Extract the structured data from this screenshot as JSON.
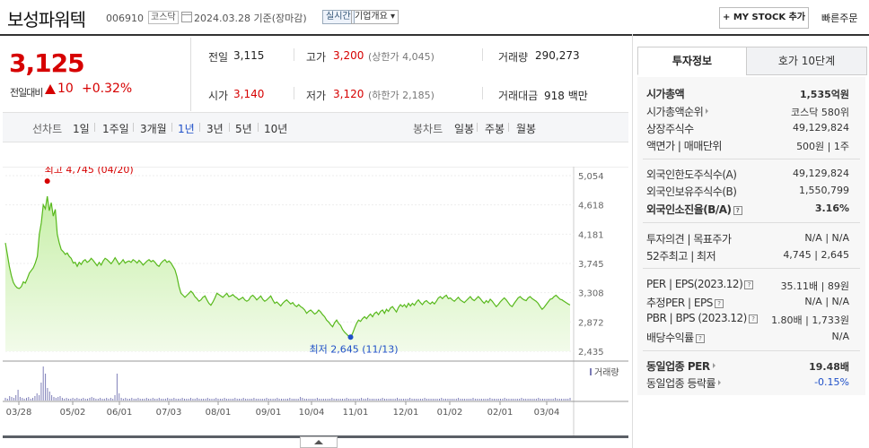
{
  "header": {
    "stock_name": "보성파워텍",
    "stock_code": "006910",
    "market": "코스닥",
    "date_text": "2024.03.28  기준(장마감)",
    "realtime_label": "실시간",
    "company_overview": "기업개요 ▾",
    "mystock_button": "+ MY STOCK 추가",
    "quick_order": "빠른주문"
  },
  "price": {
    "current": "3,125",
    "change_label": "전일대비",
    "change_value": "10",
    "change_pct": "+0.32%"
  },
  "quotes": {
    "prev_close_label": "전일",
    "prev_close": "3,115",
    "high_label": "고가",
    "high": "3,200",
    "upper_limit": "(상한가 4,045)",
    "volume_label": "거래량",
    "volume": "290,273",
    "open_label": "시가",
    "open": "3,140",
    "low_label": "저가",
    "low": "3,120",
    "lower_limit": "(하한가 2,185)",
    "trade_value_label": "거래대금",
    "trade_value": "918 백만"
  },
  "periods": {
    "line_title": "선차트",
    "line_items": [
      "1일",
      "1주일",
      "3개월",
      "1년",
      "3년",
      "5년",
      "10년"
    ],
    "active": "1년",
    "candle_title": "봉차트",
    "candle_items": [
      "일봉",
      "주봉",
      "월봉"
    ]
  },
  "chart_data": {
    "type": "area",
    "y_ticks": [
      "5,054",
      "4,618",
      "4,181",
      "3,745",
      "3,308",
      "2,872",
      "2,435"
    ],
    "ylim": [
      2435,
      5054
    ],
    "x_ticks": [
      "03/28",
      "05/02",
      "06/01",
      "07/03",
      "08/01",
      "09/01",
      "10/04",
      "11/01",
      "12/01",
      "01/02",
      "02/01",
      "03/04"
    ],
    "high_annotation": "최고 4,745 (04/20)",
    "low_annotation": "최저 2,645 (11/13)",
    "volume_label": "거래량",
    "series_color": "#58b91c",
    "fill_color": "#d8f5c4",
    "values": [
      4050,
      3880,
      3700,
      3560,
      3460,
      3410,
      3380,
      3370,
      3400,
      3470,
      3450,
      3520,
      3600,
      3640,
      3680,
      3750,
      3850,
      4180,
      4350,
      4620,
      4560,
      4745,
      4530,
      4650,
      4450,
      4550,
      4180,
      4050,
      3950,
      3920,
      3880,
      3900,
      3850,
      3820,
      3750,
      3760,
      3700,
      3760,
      3730,
      3780,
      3800,
      3760,
      3780,
      3820,
      3790,
      3750,
      3710,
      3760,
      3720,
      3780,
      3820,
      3800,
      3770,
      3740,
      3780,
      3830,
      3780,
      3730,
      3760,
      3800,
      3750,
      3770,
      3780,
      3760,
      3800,
      3780,
      3750,
      3790,
      3760,
      3720,
      3750,
      3780,
      3800,
      3770,
      3790,
      3760,
      3720,
      3700,
      3750,
      3780,
      3800,
      3760,
      3780,
      3750,
      3700,
      3650,
      3550,
      3400,
      3300,
      3270,
      3240,
      3270,
      3300,
      3330,
      3300,
      3250,
      3220,
      3180,
      3200,
      3240,
      3260,
      3200,
      3150,
      3120,
      3170,
      3230,
      3300,
      3280,
      3260,
      3240,
      3270,
      3300,
      3250,
      3260,
      3280,
      3250,
      3230,
      3200,
      3220,
      3240,
      3200,
      3180,
      3200,
      3250,
      3270,
      3240,
      3200,
      3230,
      3260,
      3210,
      3180,
      3200,
      3230,
      3260,
      3200,
      3150,
      3170,
      3140,
      3110,
      3150,
      3180,
      3200,
      3170,
      3140,
      3160,
      3120,
      3100,
      3130,
      3100,
      3080,
      3050,
      3000,
      3030,
      3050,
      3020,
      2990,
      3010,
      3050,
      3020,
      2980,
      2950,
      2900,
      2870,
      2830,
      2800,
      2860,
      2900,
      2850,
      2820,
      2760,
      2720,
      2690,
      2660,
      2645,
      2700,
      2780,
      2850,
      2900,
      2880,
      2920,
      2950,
      2920,
      2960,
      2990,
      2950,
      3000,
      3020,
      2980,
      3030,
      3050,
      3000,
      3060,
      3030,
      3080,
      3100,
      3060,
      3020,
      3090,
      3130,
      3100,
      3130,
      3090,
      3150,
      3110,
      3150,
      3120,
      3170,
      3200,
      3160,
      3130,
      3170,
      3190,
      3160,
      3140,
      3170,
      3140,
      3180,
      3230,
      3250,
      3220,
      3250,
      3270,
      3220,
      3230,
      3200,
      3180,
      3210,
      3240,
      3200,
      3180,
      3160,
      3190,
      3220,
      3250,
      3210,
      3190,
      3220,
      3250,
      3220,
      3180,
      3150,
      3190,
      3160,
      3210,
      3180,
      3140,
      3100,
      3130,
      3170,
      3200,
      3230,
      3200,
      3160,
      3120,
      3100,
      3150,
      3190,
      3230,
      3250,
      3220,
      3200,
      3190,
      3230,
      3250,
      3220,
      3200,
      3180,
      3150,
      3100,
      3060,
      3090,
      3130,
      3170,
      3210,
      3220,
      3250,
      3270,
      3240,
      3210,
      3200,
      3180,
      3160,
      3140,
      3125
    ],
    "volume_values": [
      3,
      2,
      5,
      4,
      3,
      6,
      12,
      4,
      3,
      2,
      3,
      4,
      2,
      3,
      5,
      8,
      6,
      20,
      38,
      30,
      14,
      10,
      6,
      4,
      3,
      4,
      5,
      3,
      2,
      3,
      2,
      2,
      3,
      2,
      3,
      2,
      2,
      3,
      2,
      2,
      3,
      4,
      3,
      2,
      2,
      3,
      2,
      2,
      3,
      2,
      3,
      2,
      6,
      30,
      8,
      3,
      2,
      3,
      2,
      2,
      3,
      2,
      2,
      3,
      2,
      2,
      2,
      3,
      2,
      2,
      3,
      2,
      2,
      3,
      2,
      2,
      2,
      3,
      2,
      2,
      3,
      2,
      2,
      2,
      3,
      2,
      2,
      2,
      3,
      2,
      2,
      3,
      2,
      2,
      2,
      2,
      3,
      2,
      2,
      2,
      3,
      2,
      2,
      2,
      3,
      2,
      2,
      2,
      2,
      3,
      2,
      2,
      2,
      3,
      2,
      2,
      2,
      2,
      3,
      2,
      2,
      2,
      2,
      2,
      3,
      2,
      2,
      2,
      2,
      3,
      2,
      2,
      2,
      2,
      2,
      3,
      2,
      2,
      2,
      2,
      4,
      3,
      2,
      2,
      2,
      2,
      2,
      2,
      3,
      2,
      2,
      2,
      2,
      2,
      2,
      3,
      2,
      2,
      2,
      2,
      2,
      2,
      3,
      2,
      2,
      2,
      2,
      2,
      2,
      3,
      2,
      2,
      3,
      2,
      2,
      2,
      2,
      2,
      2,
      3,
      2,
      2,
      2,
      2,
      2,
      2,
      3,
      2,
      2,
      2,
      2,
      2,
      3,
      2,
      2,
      2,
      2,
      2,
      2,
      3,
      2,
      2,
      2,
      2,
      2,
      2,
      2,
      3,
      2,
      2,
      2,
      2,
      2,
      2,
      2,
      3,
      2,
      2,
      2,
      2,
      2,
      2,
      3,
      2,
      2,
      2,
      2,
      2,
      2,
      2,
      3,
      2,
      2,
      2,
      2,
      2,
      2,
      3,
      2,
      2,
      2,
      2,
      2,
      2,
      2,
      3,
      2,
      2,
      2,
      2,
      2,
      2,
      2,
      3,
      2,
      2,
      2,
      2,
      2,
      2,
      2,
      3,
      2,
      2,
      2,
      2,
      2,
      2,
      3
    ]
  },
  "right_panel": {
    "tab_invest": "투자정보",
    "tab_orderbook": "호가 10단계",
    "rows": [
      {
        "label": "시가총액",
        "value": "1,535억원"
      },
      {
        "label": "시가총액순위",
        "value": "코스닥 580위"
      },
      {
        "label": "상장주식수",
        "value": "49,129,824"
      },
      {
        "label": "액면가 | 매매단위",
        "value": "500원 | 1주"
      },
      {
        "label": "외국인한도주식수(A)",
        "value": "49,129,824"
      },
      {
        "label": "외국인보유주식수(B)",
        "value": "1,550,799"
      },
      {
        "label": "외국인소진율(B/A)",
        "value": "3.16%"
      },
      {
        "label": "투자의견 | 목표주가",
        "value": "N/A | N/A"
      },
      {
        "label": "52주최고 | 최저",
        "value": "4,745 | 2,645"
      },
      {
        "label": "PER | EPS(2023.12)",
        "value": "35.11배 | 89원"
      },
      {
        "label": "추정PER | EPS",
        "value": "N/A | N/A"
      },
      {
        "label": "PBR | BPS (2023.12)",
        "value": "1.80배 | 1,733원"
      },
      {
        "label": "배당수익률",
        "value": "N/A"
      },
      {
        "label": "동일업종 PER",
        "value": "19.48배"
      },
      {
        "label": "동일업종 등락률",
        "value": "-0.15%"
      }
    ]
  }
}
